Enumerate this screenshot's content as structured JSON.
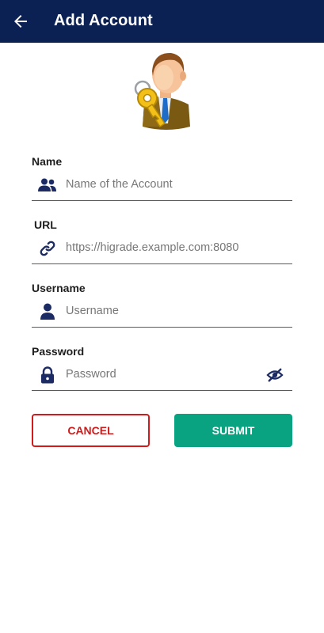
{
  "header": {
    "title": "Add Account",
    "back_icon": "arrow-left-icon"
  },
  "avatar": {
    "icon": "user-key-icon"
  },
  "form": {
    "name": {
      "label": "Name",
      "placeholder": "Name of the Account",
      "value": "",
      "icon": "users-icon"
    },
    "url": {
      "label": "URL",
      "placeholder": "https://higrade.example.com:8080",
      "value": "",
      "icon": "link-icon"
    },
    "username": {
      "label": "Username",
      "placeholder": "Username",
      "value": "",
      "icon": "user-icon"
    },
    "password": {
      "label": "Password",
      "placeholder": "Password",
      "value": "",
      "icon": "lock-icon",
      "visibility_icon": "eye-off-icon"
    }
  },
  "actions": {
    "cancel_label": "CANCEL",
    "submit_label": "SUBMIT"
  },
  "colors": {
    "appbar": "#0b2154",
    "icon": "#1c2b63",
    "cancel": "#d21a1a",
    "submit": "#0aa382"
  }
}
